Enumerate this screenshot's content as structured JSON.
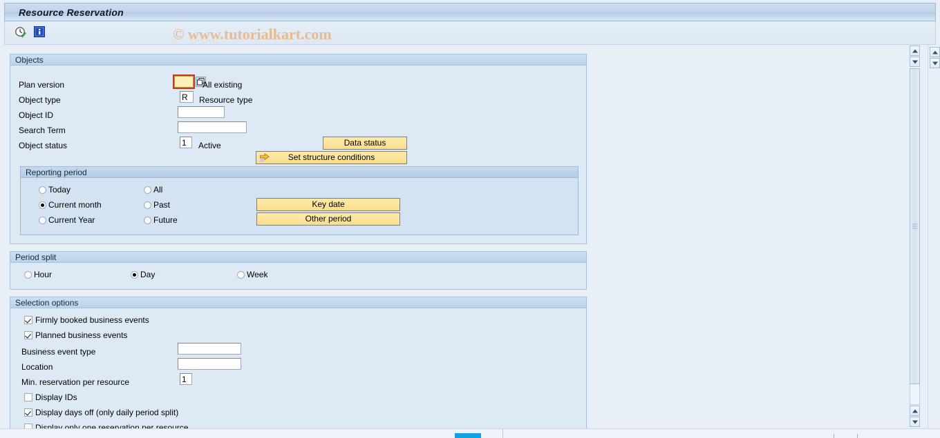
{
  "window": {
    "title": "Resource Reservation"
  },
  "toolbar": {
    "execute_icon": "clock-check-execute-icon",
    "info_icon": "information-icon"
  },
  "watermark": {
    "text": "© www.tutorialkart.com",
    "color": "#e8b98a"
  },
  "objects": {
    "title": "Objects",
    "plan_version": {
      "label": "Plan version",
      "value": "",
      "focused": true,
      "helper_icon": "multiple-selection-icon",
      "helper_text": "All existing"
    },
    "object_type": {
      "label": "Object type",
      "value": "R",
      "description": "Resource type"
    },
    "object_id": {
      "label": "Object ID",
      "value": ""
    },
    "search_term": {
      "label": "Search Term",
      "value": ""
    },
    "object_status": {
      "label": "Object status",
      "value": "1",
      "description": "Active"
    },
    "buttons": {
      "data_status": "Data status",
      "set_structure_conditions": "Set structure conditions",
      "set_structure_conditions_icon": "yellow-arrow-right-icon"
    }
  },
  "reporting_period": {
    "title": "Reporting period",
    "options_left": [
      {
        "label": "Today",
        "selected": false
      },
      {
        "label": "Current month",
        "selected": true
      },
      {
        "label": "Current Year",
        "selected": false
      }
    ],
    "options_right": [
      {
        "label": "All",
        "selected": false
      },
      {
        "label": "Past",
        "selected": false
      },
      {
        "label": "Future",
        "selected": false
      }
    ],
    "buttons": {
      "key_date": "Key date",
      "other_period": "Other period"
    }
  },
  "period_split": {
    "title": "Period split",
    "options": [
      {
        "label": "Hour",
        "selected": false
      },
      {
        "label": "Day",
        "selected": true
      },
      {
        "label": "Week",
        "selected": false
      }
    ]
  },
  "selection_options": {
    "title": "Selection options",
    "checkboxes_top": [
      {
        "label": "Firmly booked business events",
        "checked": true
      },
      {
        "label": "Planned business events",
        "checked": true
      }
    ],
    "business_event_type": {
      "label": "Business event type",
      "value": ""
    },
    "location": {
      "label": "Location",
      "value": ""
    },
    "min_reservation": {
      "label": "Min. reservation per resource",
      "value": "1"
    },
    "checkboxes_bottom": [
      {
        "label": "Display IDs",
        "checked": false
      },
      {
        "label": "Display days off (only daily period split)",
        "checked": true
      },
      {
        "label": "Display only one reservation per resource",
        "checked": false
      }
    ]
  },
  "scrollbars": {
    "outer_up_label": "▲",
    "outer_down_label": "▼",
    "inner_up_label": "▲",
    "inner_down_label": "▼"
  }
}
